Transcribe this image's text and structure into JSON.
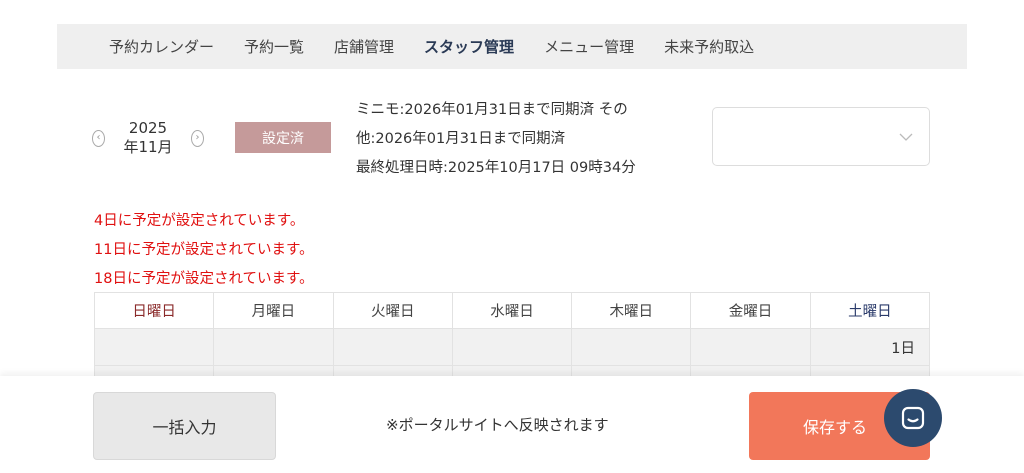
{
  "nav": {
    "items": [
      {
        "label": "予約カレンダー"
      },
      {
        "label": "予約一覧"
      },
      {
        "label": "店舗管理"
      },
      {
        "label": "スタッフ管理"
      },
      {
        "label": "メニュー管理"
      },
      {
        "label": "未来予約取込"
      }
    ],
    "active_index": 3
  },
  "month": {
    "year": "2025",
    "month": "年11月"
  },
  "status_badge": "設定済",
  "sync": {
    "line1": "ミニモ:2026年01月31日まで同期済 その",
    "line2": "他:2026年01月31日まで同期済",
    "line3": "最終処理日時:2025年10月17日 09時34分"
  },
  "select": {
    "value": ""
  },
  "warnings": [
    "4日に予定が設定されています。",
    "11日に予定が設定されています。",
    "18日に予定が設定されています。"
  ],
  "calendar": {
    "weekdays": [
      "日曜日",
      "月曜日",
      "火曜日",
      "水曜日",
      "木曜日",
      "金曜日",
      "土曜日"
    ],
    "row1": [
      "",
      "",
      "",
      "",
      "",
      "",
      "1日"
    ]
  },
  "footer": {
    "bulk_button": "一括入力",
    "note": "※ポータルサイトへ反映されます",
    "save_button": "保存する"
  },
  "colors": {
    "accent_save": "#f2775a",
    "badge": "#c59a9a",
    "warning": "#e01010",
    "chat": "#2c4a6e"
  },
  "icons": {
    "prev": "chevron-left-icon",
    "next": "chevron-right-icon",
    "dropdown": "chevron-down-icon",
    "chat": "chat-icon"
  }
}
